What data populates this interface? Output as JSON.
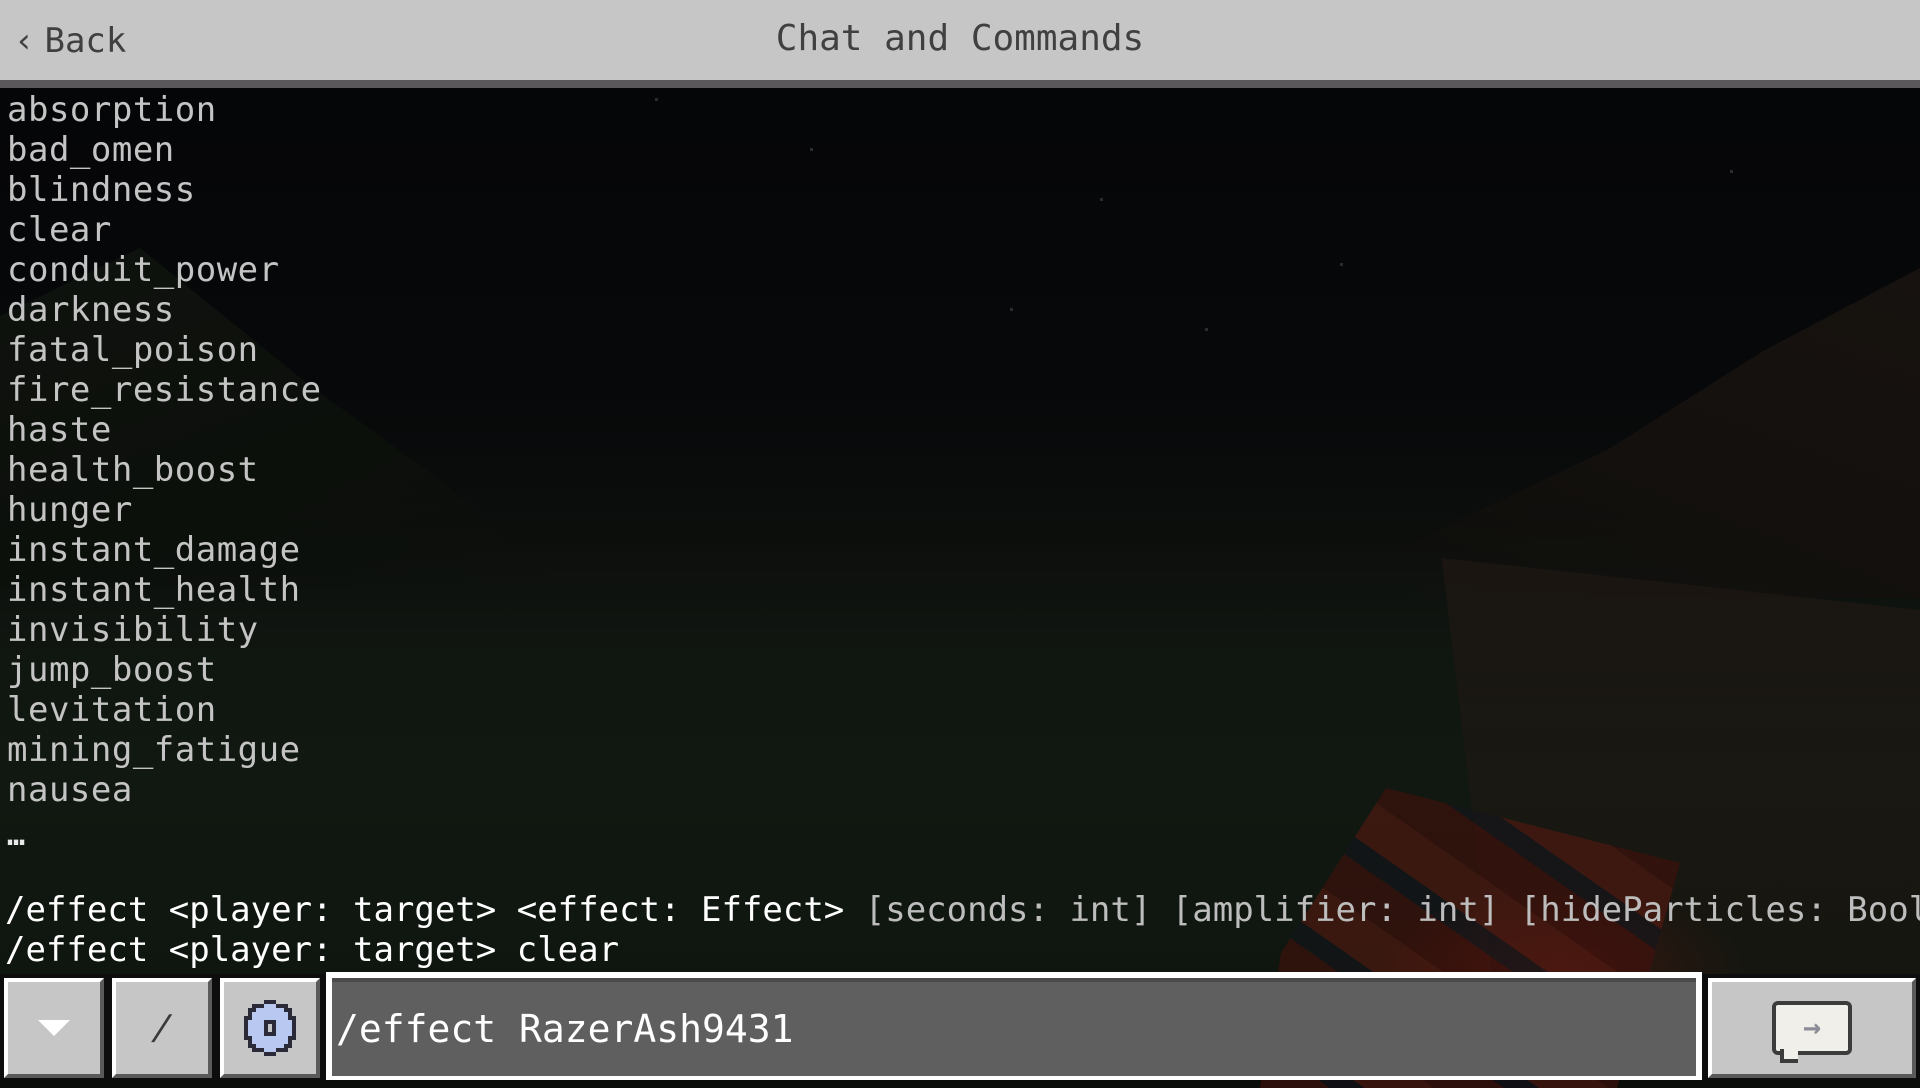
{
  "header": {
    "back_label": "Back",
    "back_icon": "chevron-left-icon",
    "title": "Chat and Commands"
  },
  "suggestions": {
    "effects": [
      "absorption",
      "bad_omen",
      "blindness",
      "clear",
      "conduit_power",
      "darkness",
      "fatal_poison",
      "fire_resistance",
      "haste",
      "health_boost",
      "hunger",
      "instant_damage",
      "instant_health",
      "invisibility",
      "jump_boost",
      "levitation",
      "mining_fatigue",
      "nausea"
    ],
    "more_indicator": "…"
  },
  "usage": {
    "line1_required": "/effect <player: target> <effect: Effect>",
    "line1_optional": "[seconds: int] [amplifier: int] [hideParticles: Boolean]",
    "line2": "/effect <player: target> clear"
  },
  "input_bar": {
    "collapse_icon": "triangle-down-icon",
    "slash_label": "/",
    "settings_icon": "gear-icon",
    "command_value": "/effect RazerAsh9431",
    "send_icon": "chat-send-arrow-icon"
  },
  "colors": {
    "header_bg": "#c6c6c6",
    "header_text": "#404040",
    "suggestion_text": "#c4c4c4",
    "usage_text": "#ffffff",
    "optional_text": "#bdbdbd",
    "input_bg": "#5f5f5f",
    "gear_accent": "#b9c8f0"
  }
}
